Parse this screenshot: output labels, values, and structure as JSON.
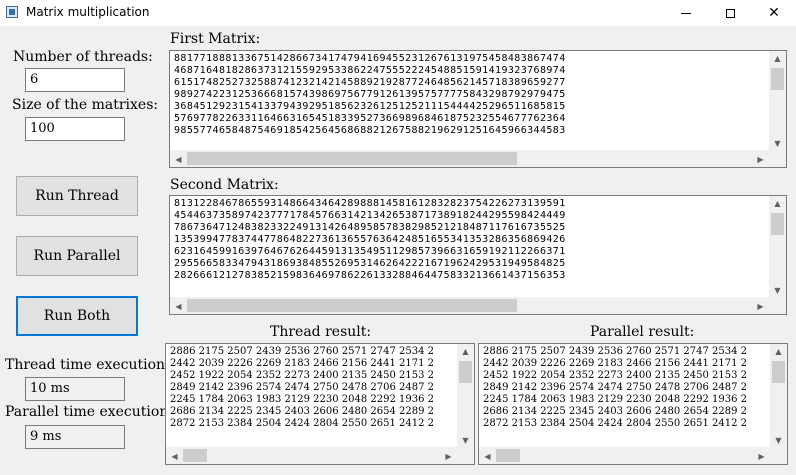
{
  "window": {
    "title": "Matrix multiplication"
  },
  "controls": {
    "threads_label": "Number of threads:",
    "threads_value": "6",
    "size_label": "Size of the matrixes:",
    "size_value": "100",
    "run_thread": "Run Thread",
    "run_parallel": "Run Parallel",
    "run_both": "Run Both",
    "thread_time_label": "Thread time execution:",
    "thread_time_value": "10 ms",
    "parallel_time_label": "Parallel time execution:",
    "parallel_time_value": "9 ms"
  },
  "first_matrix": {
    "label": "First Matrix:",
    "text": "8817718881336751428667341747941694552312676131975458483867474\n4687164818286373121559295338622475552224548851591419323768974\n6151748252732588741232142145889219287724648562145718389659277\n9892742231253666815743986975677912613957577775843298792979475\n3684512923154133794392951856232612512521115444425296511685815\n5769778226331164663165451833952736698968461875232554677762364\n9855774658487546918542564568688212675882196291251645966344583"
  },
  "second_matrix": {
    "label": "Second Matrix:",
    "text": "8131228467865593148664346428988814581612832823754226273139591\n4544637358974237771784576631421342653871738918244295598424449\n7867364712483823322491314264895857838298521218487117616735525\n1353994778374477864822736136557636424851655341353286356869426\n6231645991639764676264459131354951129857396631659192112266371\n2955665833479431869384855269531462642221671962429531949584825\n2826661212783852159836469786226133288464475833213661437156353"
  },
  "thread_result": {
    "label": "Thread result:",
    "text": "2886 2175 2507 2439 2536 2760 2571 2747 2534 2\n2442 2039 2226 2269 2183 2466 2156 2441 2171 2\n2452 1922 2054 2352 2273 2400 2135 2450 2153 2\n2849 2142 2396 2574 2474 2750 2478 2706 2487 2\n2245 1784 2063 1983 2129 2230 2048 2292 1936 2\n2686 2134 2225 2345 2403 2606 2480 2654 2289 2\n2872 2153 2384 2504 2424 2804 2550 2651 2412 2"
  },
  "parallel_result": {
    "label": "Parallel result:",
    "text": "2886 2175 2507 2439 2536 2760 2571 2747 2534 2\n2442 2039 2226 2269 2183 2466 2156 2441 2171 2\n2452 1922 2054 2352 2273 2400 2135 2450 2153 2\n2849 2142 2396 2574 2474 2750 2478 2706 2487 2\n2245 1784 2063 1983 2129 2230 2048 2292 1936 2\n2686 2134 2225 2345 2403 2606 2480 2654 2289 2\n2872 2153 2384 2504 2424 2804 2550 2651 2412 2"
  }
}
